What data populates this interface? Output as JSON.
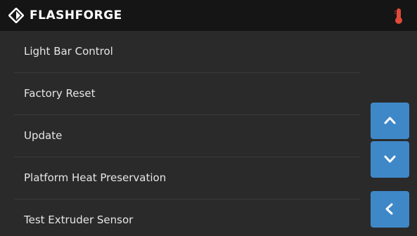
{
  "header": {
    "brand": "FLASHFORGE",
    "logo_icon": "flashforge-logo-icon",
    "status_icon": "thermometer-icon"
  },
  "menu": {
    "items": [
      {
        "label": "Light Bar Control"
      },
      {
        "label": "Factory Reset"
      },
      {
        "label": "Update"
      },
      {
        "label": "Platform Heat Preservation"
      },
      {
        "label": "Test Extruder Sensor"
      }
    ]
  },
  "nav": {
    "scroll_up_icon": "chevron-up-icon",
    "scroll_down_icon": "chevron-down-icon",
    "back_icon": "chevron-left-icon"
  },
  "colors": {
    "background": "#2a2a2a",
    "header": "#151515",
    "accent": "#3f88c8",
    "thermometer": "#e04a3a"
  }
}
